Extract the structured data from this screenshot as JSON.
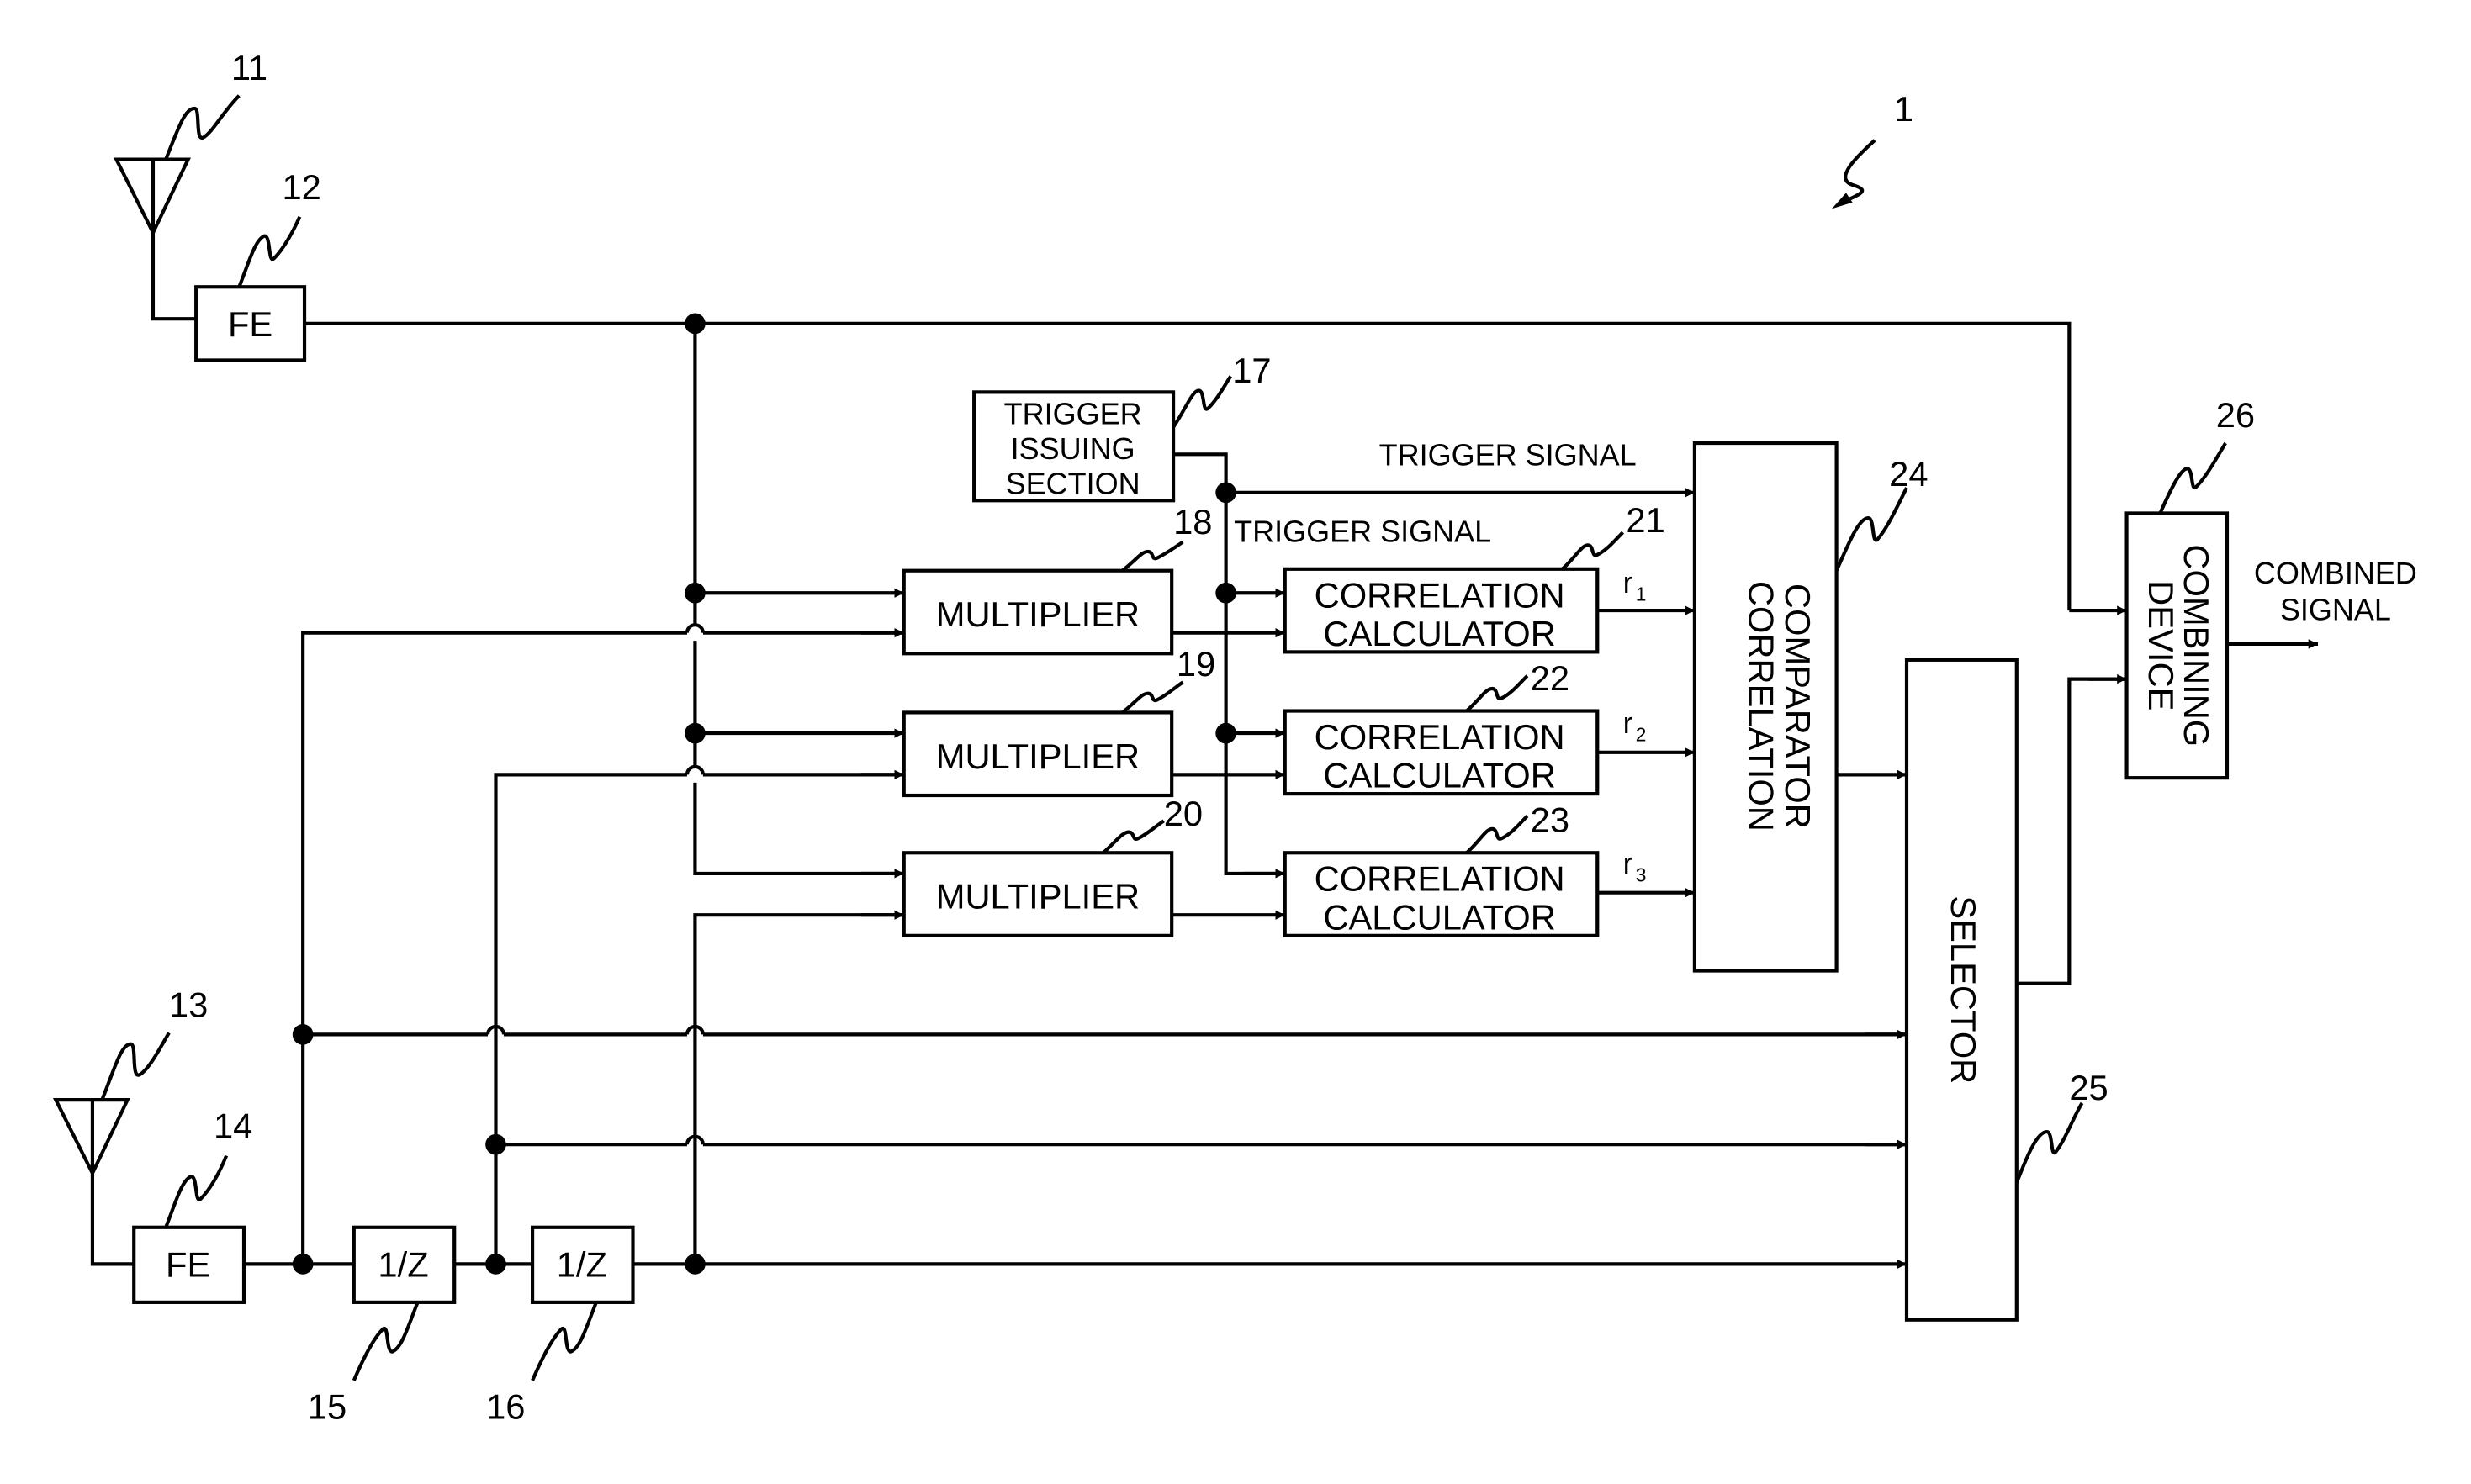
{
  "figure": {
    "ref": "1"
  },
  "antennas": [
    {
      "ref": "11"
    },
    {
      "ref": "13"
    }
  ],
  "front_ends": [
    {
      "label": "FE",
      "ref": "12"
    },
    {
      "label": "FE",
      "ref": "14"
    }
  ],
  "delays": [
    {
      "label": "1/Z",
      "ref": "15"
    },
    {
      "label": "1/Z",
      "ref": "16"
    }
  ],
  "trigger_section": {
    "lines": [
      "TRIGGER",
      "ISSUING",
      "SECTION"
    ],
    "ref": "17"
  },
  "multipliers": [
    {
      "label": "MULTIPLIER",
      "ref": "18"
    },
    {
      "label": "MULTIPLIER",
      "ref": "19"
    },
    {
      "label": "MULTIPLIER",
      "ref": "20"
    }
  ],
  "correlation_calculators": [
    {
      "line1": "CORRELATION",
      "line2": "CALCULATOR",
      "ref": "21",
      "output": "r",
      "output_sub": "1"
    },
    {
      "line1": "CORRELATION",
      "line2": "CALCULATOR",
      "ref": "22",
      "output": "r",
      "output_sub": "2"
    },
    {
      "line1": "CORRELATION",
      "line2": "CALCULATOR",
      "ref": "23",
      "output": "r",
      "output_sub": "3"
    }
  ],
  "comparator": {
    "line1": "CORRELATION",
    "line2": "COMPARATOR",
    "ref": "24"
  },
  "selector": {
    "label": "SELECTOR",
    "ref": "25"
  },
  "combiner": {
    "line1": "COMBINING",
    "line2": "DEVICE",
    "ref": "26"
  },
  "signals": {
    "trigger_top": "TRIGGER SIGNAL",
    "trigger_mid": "TRIGGER SIGNAL",
    "output_line1": "COMBINED",
    "output_line2": "SIGNAL"
  }
}
